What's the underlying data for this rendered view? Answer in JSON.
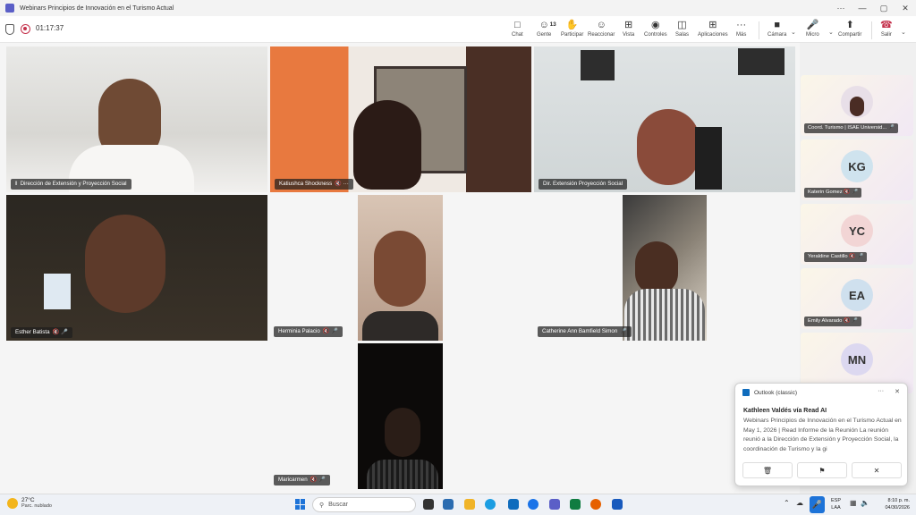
{
  "window": {
    "title": "Webinars Principios de Innovación en el Turismo Actual"
  },
  "meeting": {
    "timer": "01:17:37",
    "toolbar": {
      "chat": "Chat",
      "people": "Gente",
      "people_count": "13",
      "raise": "Participar",
      "react": "Reaccionar",
      "view": "Vista",
      "controls": "Controles",
      "rooms": "Salas",
      "apps": "Aplicaciones",
      "more": "Más",
      "camera": "Cámara",
      "mic": "Micro",
      "share": "Compartir",
      "leave": "Salir"
    }
  },
  "participants": [
    {
      "name": "Dirección de Extensión y Proyección Social"
    },
    {
      "name": "Katiushca Shockness"
    },
    {
      "name": "Dir. Extensión Proyección Social"
    },
    {
      "name": "Esther Batista"
    },
    {
      "name": "Herminia Palacio"
    },
    {
      "name": "Catherine Ann Bamfield Simon"
    },
    {
      "name": "Maricarmen"
    }
  ],
  "sidebar": [
    {
      "name": "Coord. Turismo | ISAE Universid...",
      "initials": "",
      "color": "#e8dfe8"
    },
    {
      "name": "Katerin Gomez",
      "initials": "KG",
      "color": "#cfe3ee"
    },
    {
      "name": "Yeraldine Castillo",
      "initials": "YC",
      "color": "#f2d5d5"
    },
    {
      "name": "Emily Alvarado",
      "initials": "EA",
      "color": "#cfe0ee"
    },
    {
      "name": "",
      "initials": "MN",
      "color": "#dcd8f0"
    }
  ],
  "toast": {
    "app": "Outlook (classic)",
    "from": "Kathleen Valdés vía Read AI",
    "body": "Webinars Principios de Innovación en el Turismo Actual en May 1, 2026 | Read Informe de la Reunión La reunión reunió a la Dirección de Extensión y Proyección Social, la coordinación de Turismo y la gi"
  },
  "taskbar": {
    "temp": "27°C",
    "weather": "Parc. nublado",
    "search": "Buscar",
    "lang1": "ESP",
    "lang2": "LAA",
    "time": "8:10 p. m.",
    "date": "04/30/2026"
  }
}
